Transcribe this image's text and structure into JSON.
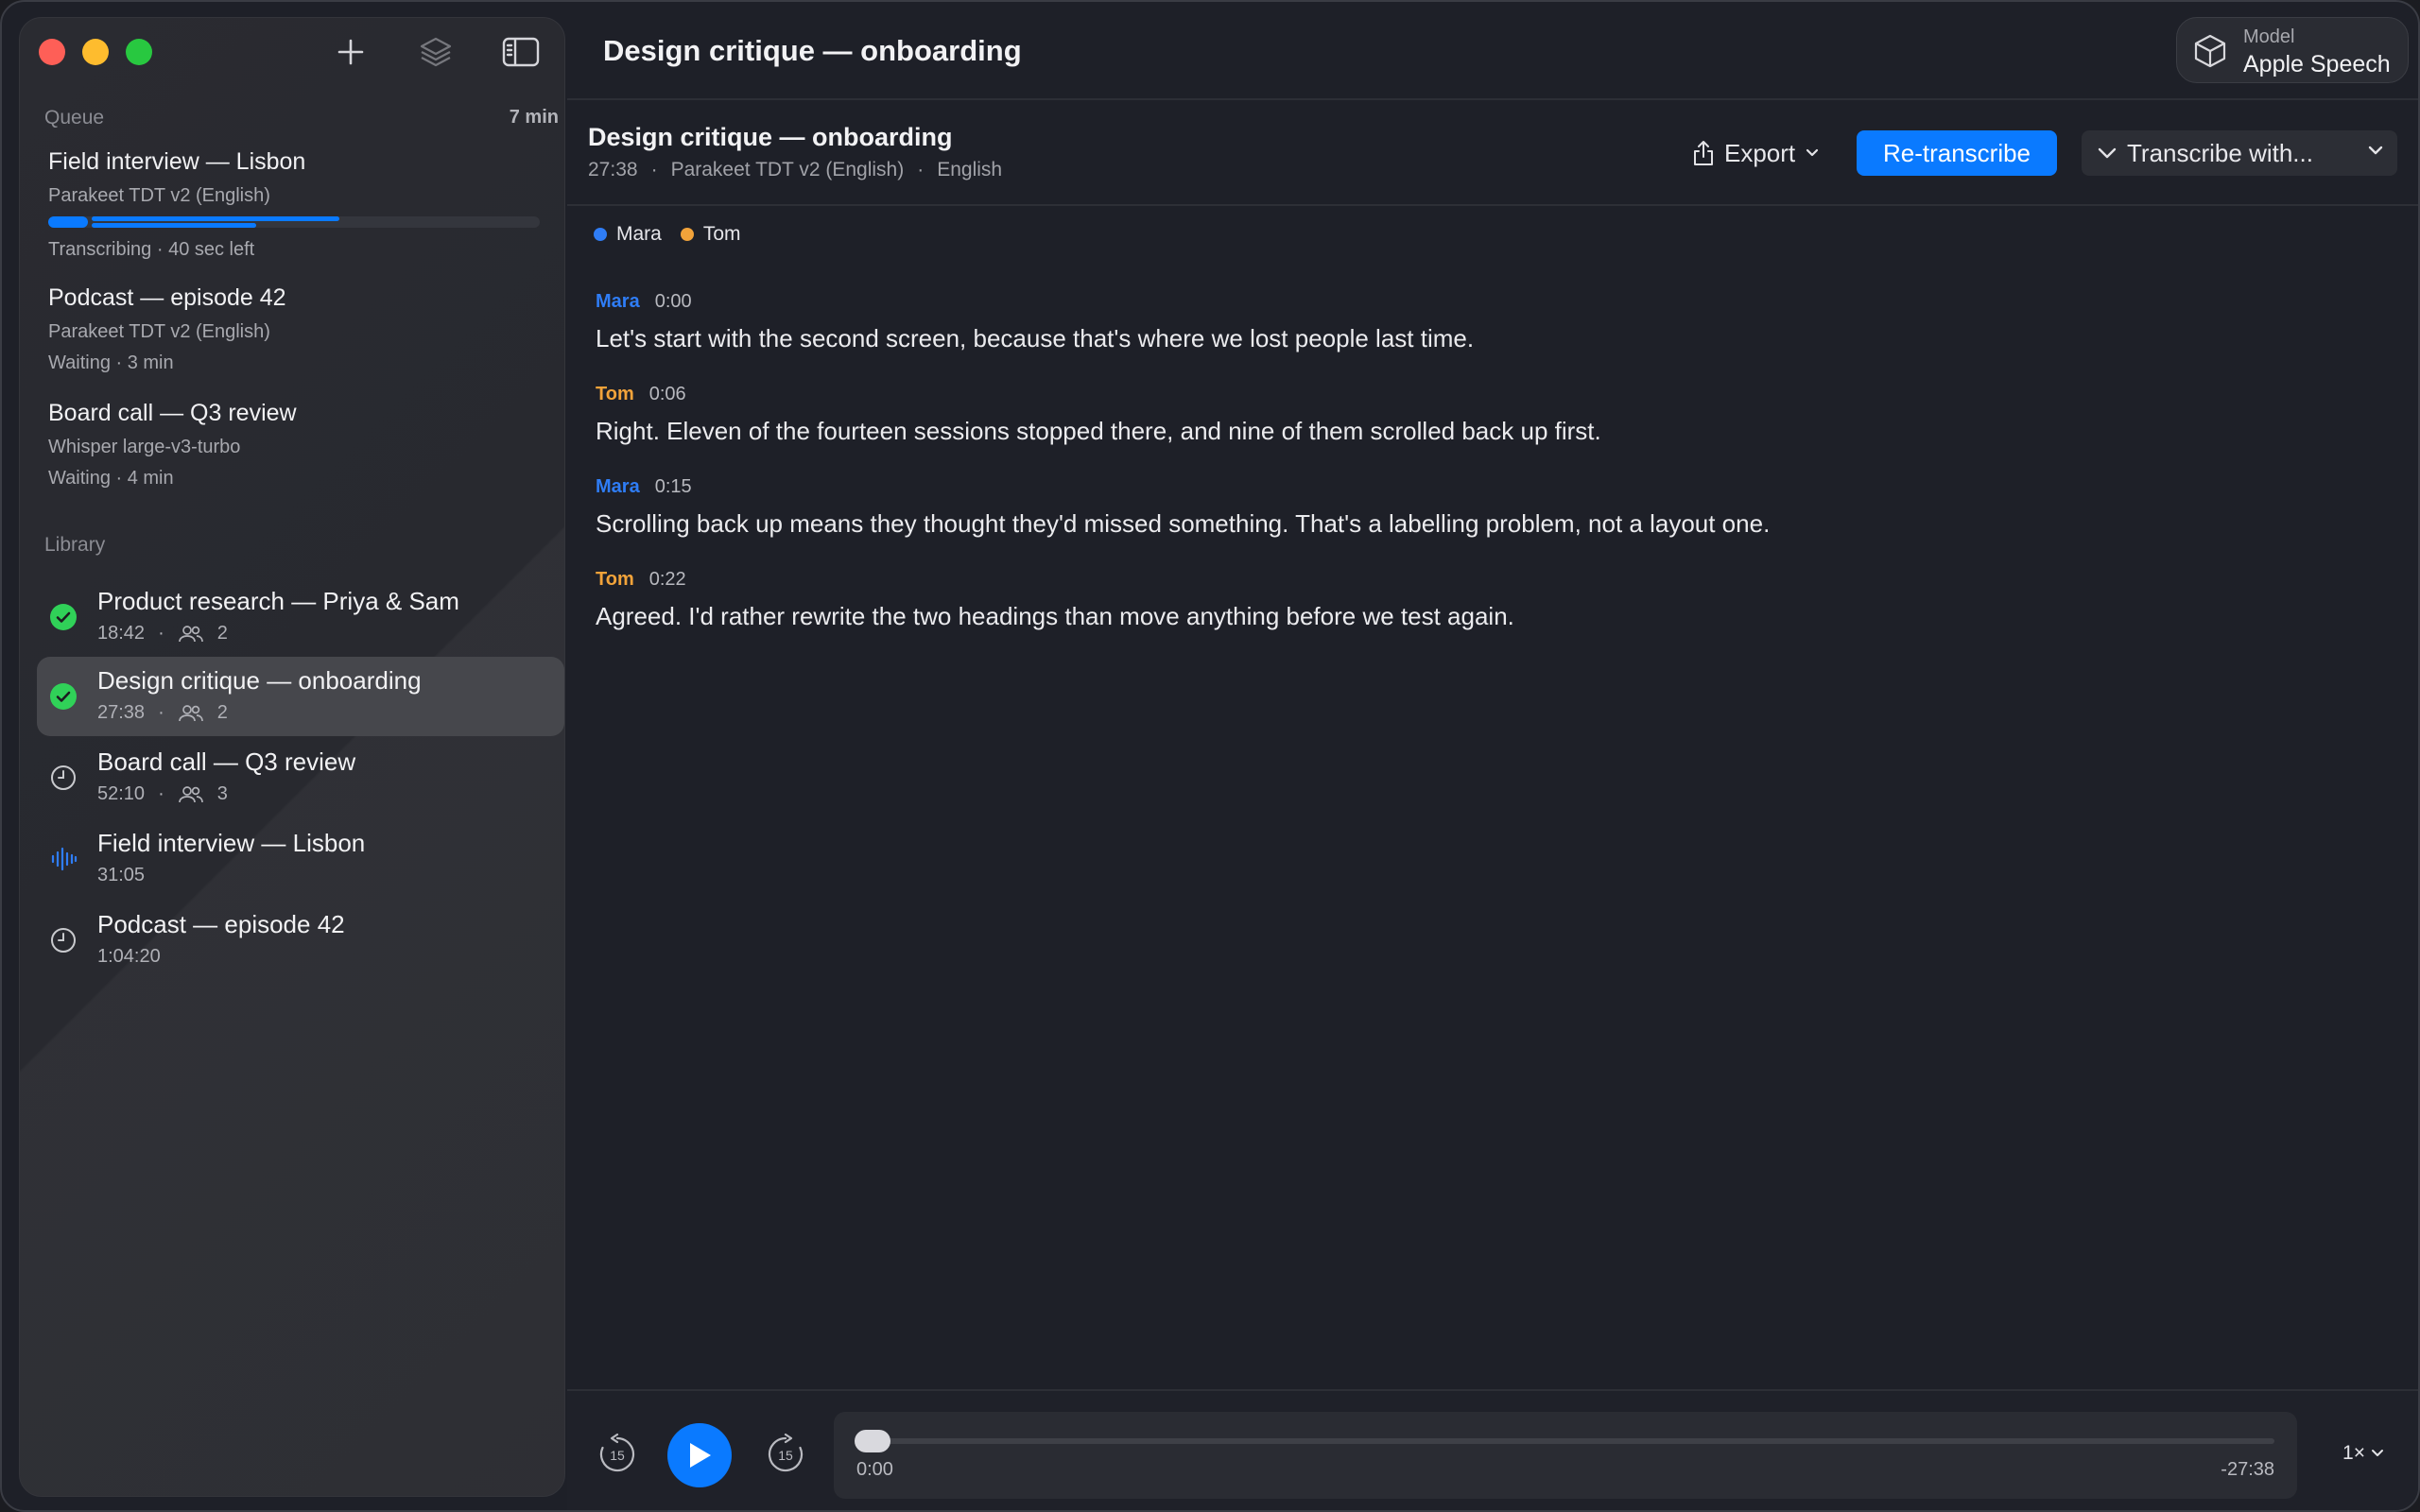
{
  "sidebar": {
    "queue": {
      "label": "Queue",
      "total": "7 min",
      "items": [
        {
          "title": "Field interview — Lisbon",
          "model": "Parakeet TDT v2 (English)",
          "status": "Transcribing · 40 sec left",
          "progress": 0.6
        },
        {
          "title": "Podcast — episode 42",
          "model": "Parakeet TDT v2 (English)",
          "status": "Waiting · 3 min"
        },
        {
          "title": "Board call — Q3 review",
          "model": "Whisper large-v3-turbo",
          "status": "Waiting · 4 min"
        }
      ]
    },
    "library": {
      "label": "Library",
      "items": [
        {
          "title": "Product research — Priya & Sam",
          "duration": "18:42",
          "sep": "·",
          "speakers": "2",
          "icon": "check-circle-icon"
        },
        {
          "title": "Design critique — onboarding",
          "duration": "27:38",
          "sep": "·",
          "speakers": "2",
          "icon": "check-circle-icon",
          "selected": true
        },
        {
          "title": "Board call — Q3 review",
          "duration": "52:10",
          "sep": "·",
          "speakers": "3",
          "icon": "clock-icon"
        },
        {
          "title": "Field interview — Lisbon",
          "duration": "31:05",
          "icon": "waveform-icon"
        },
        {
          "title": "Podcast — episode 42",
          "duration": "1:04:20",
          "icon": "clock-icon"
        }
      ]
    }
  },
  "header": {
    "title": "Design critique — onboarding",
    "model_label": "Model",
    "model_value": "Apple Speech"
  },
  "doc": {
    "title": "Design critique — onboarding",
    "duration": "27:38",
    "sep": "·",
    "model": "Parakeet TDT v2 (English)",
    "language": "English"
  },
  "actions": {
    "export": "Export",
    "retranscribe": "Re-transcribe",
    "transcribe_with": "Transcribe with..."
  },
  "speakers": [
    {
      "name": "Mara",
      "color": "#2f7df6"
    },
    {
      "name": "Tom",
      "color": "#f2a33a"
    }
  ],
  "transcript": [
    {
      "speaker": "Mara",
      "time": "0:00",
      "text": "Let's start with the second screen, because that's where we lost people last time."
    },
    {
      "speaker": "Tom",
      "time": "0:06",
      "text": "Right. Eleven of the fourteen sessions stopped there, and nine of them scrolled back up first."
    },
    {
      "speaker": "Mara",
      "time": "0:15",
      "text": "Scrolling back up means they thought they'd missed something. That's a labelling problem, not a layout one."
    },
    {
      "speaker": "Tom",
      "time": "0:22",
      "text": "Agreed. I'd rather rewrite the two headings than move anything before we test again."
    }
  ],
  "player": {
    "skip_seconds": "15",
    "current": "0:00",
    "remaining": "-27:38",
    "speed": "1×"
  },
  "colors": {
    "accent": "#0a7aff",
    "success": "#30d158",
    "mara": "#2f7df6",
    "tom": "#f2a33a"
  }
}
